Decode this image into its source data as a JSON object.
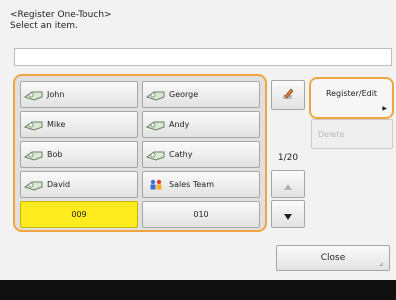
{
  "header": {
    "title": "<Register One-Touch>",
    "instruction": "Select an item."
  },
  "search": {
    "value": ""
  },
  "destinations": [
    {
      "label": "John",
      "icon": "person-icon"
    },
    {
      "label": "George",
      "icon": "person-icon"
    },
    {
      "label": "Mike",
      "icon": "person-icon"
    },
    {
      "label": "Andy",
      "icon": "person-icon"
    },
    {
      "label": "Bob",
      "icon": "person-icon"
    },
    {
      "label": "Cathy",
      "icon": "person-icon"
    },
    {
      "label": "David",
      "icon": "person-icon"
    },
    {
      "label": "Sales Team",
      "icon": "group-icon"
    },
    {
      "label": "009",
      "icon": "",
      "selected": true
    },
    {
      "label": "010",
      "icon": ""
    }
  ],
  "side": {
    "page": "1/20",
    "up_icon": "triangle-up-icon",
    "down_icon": "triangle-down-icon",
    "edit_icon": "edit-pen-icon"
  },
  "actions": {
    "register_edit": "Register/Edit",
    "delete": "Delete",
    "close": "Close"
  },
  "colors": {
    "highlight": "#f0a640",
    "selected": "#ffec1f",
    "bottom_bar": "#0f0f0f"
  }
}
